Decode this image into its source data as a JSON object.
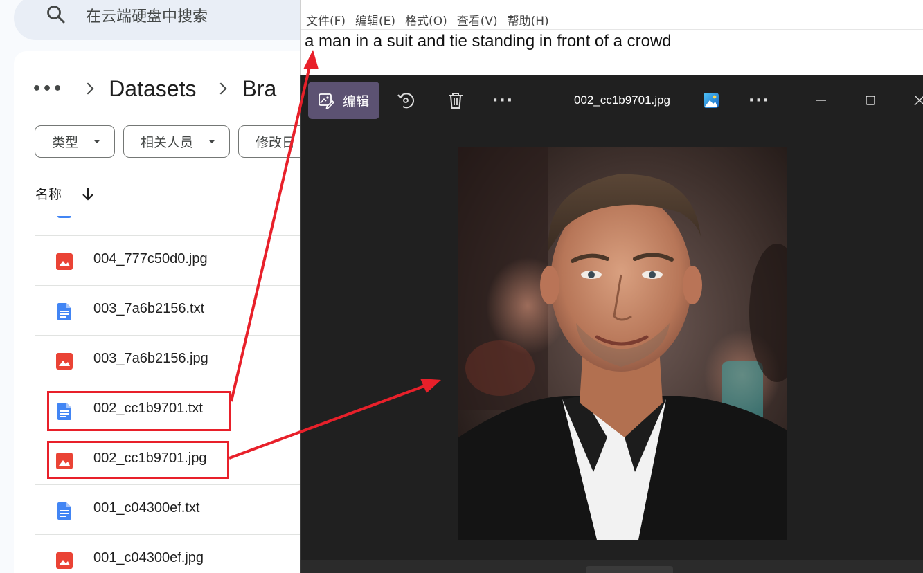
{
  "drive": {
    "search_placeholder": "在云端硬盘中搜索",
    "breadcrumb": {
      "more": "•••",
      "items": [
        "Datasets",
        "Bra"
      ]
    },
    "filters": [
      "类型",
      "相关人员",
      "修改日"
    ],
    "column_header": "名称",
    "files": [
      {
        "name": "004_777c50d0.jpg",
        "type": "image"
      },
      {
        "name": "003_7a6b2156.txt",
        "type": "doc"
      },
      {
        "name": "003_7a6b2156.jpg",
        "type": "image"
      },
      {
        "name": "002_cc1b9701.txt",
        "type": "doc",
        "highlighted": true
      },
      {
        "name": "002_cc1b9701.jpg",
        "type": "image",
        "highlighted": true
      },
      {
        "name": "001_c04300ef.txt",
        "type": "doc"
      },
      {
        "name": "001_c04300ef.jpg",
        "type": "image"
      }
    ]
  },
  "notepad": {
    "menu": [
      "文件(F)",
      "编辑(E)",
      "格式(O)",
      "查看(V)",
      "帮助(H)"
    ],
    "content": "a man in a suit and tie standing in front of a crowd"
  },
  "viewer": {
    "edit_label": "编辑",
    "file_title": "002_cc1b9701.jpg",
    "more_dots": "···",
    "icons": [
      "edit-image-icon",
      "rotate-icon",
      "delete-icon",
      "more-icon",
      "photos-app-icon",
      "minimize-icon",
      "maximize-icon",
      "close-icon"
    ]
  },
  "colors": {
    "annotation_red": "#e8202a",
    "doc_blue": "#4285f4",
    "image_red": "#ea4335",
    "viewer_bg": "#202020",
    "edit_button": "#5c5272"
  }
}
